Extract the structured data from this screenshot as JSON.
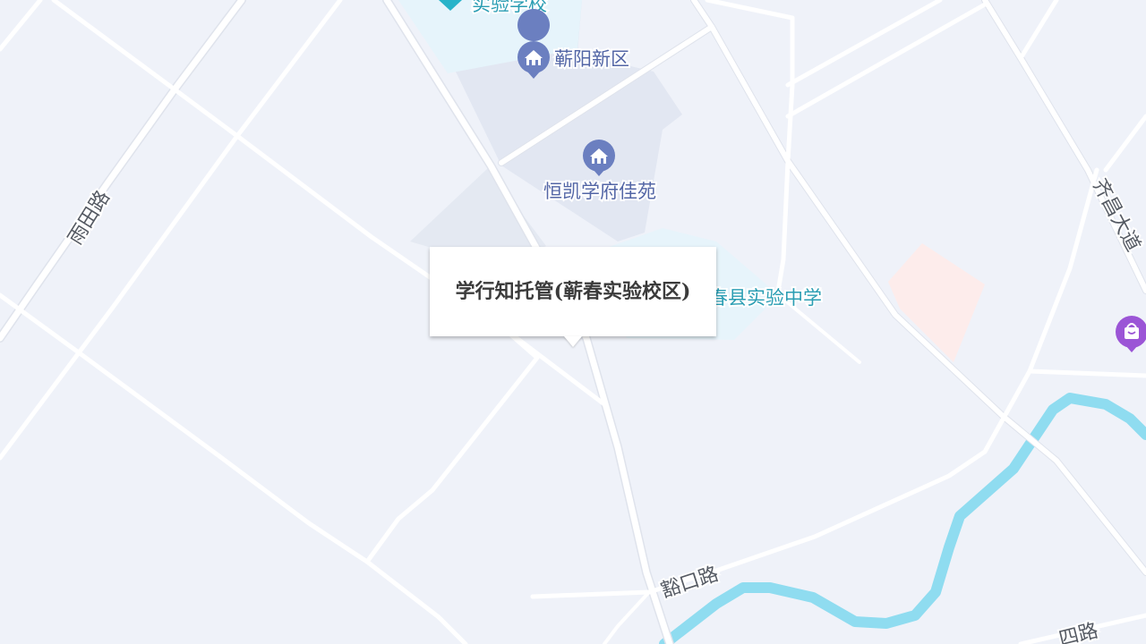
{
  "map": {
    "colors": {
      "background": "#eff2f9",
      "road": "#ffffff",
      "river": "#8fdcf0",
      "residential_area": "#e2e7f2",
      "school_area": "#e6f4fb",
      "commercial_area": "#fdeceb",
      "poi_residential": "#6b7fc0",
      "poi_school": "#27b3c9",
      "poi_shopping": "#9b55d6"
    },
    "pois": [
      {
        "label": "实验学校",
        "category": "school",
        "icon": "school-pin-icon"
      },
      {
        "label": "蕲阳新区",
        "category": "residential",
        "icon": "residential-building-icon"
      },
      {
        "label": "恒凯学府佳苑",
        "category": "residential",
        "icon": "residential-building-icon"
      },
      {
        "label": "春县实验中学",
        "category": "school",
        "icon": "school-pin-icon"
      },
      {
        "label": "",
        "category": "shopping",
        "icon": "shopping-bag-icon"
      }
    ],
    "roads": [
      {
        "label": "雨田路"
      },
      {
        "label": "齐昌大道"
      },
      {
        "label": "豁口路"
      },
      {
        "label": "四路"
      }
    ]
  },
  "popup": {
    "title": "学行知托管(蕲春实验校区)"
  }
}
